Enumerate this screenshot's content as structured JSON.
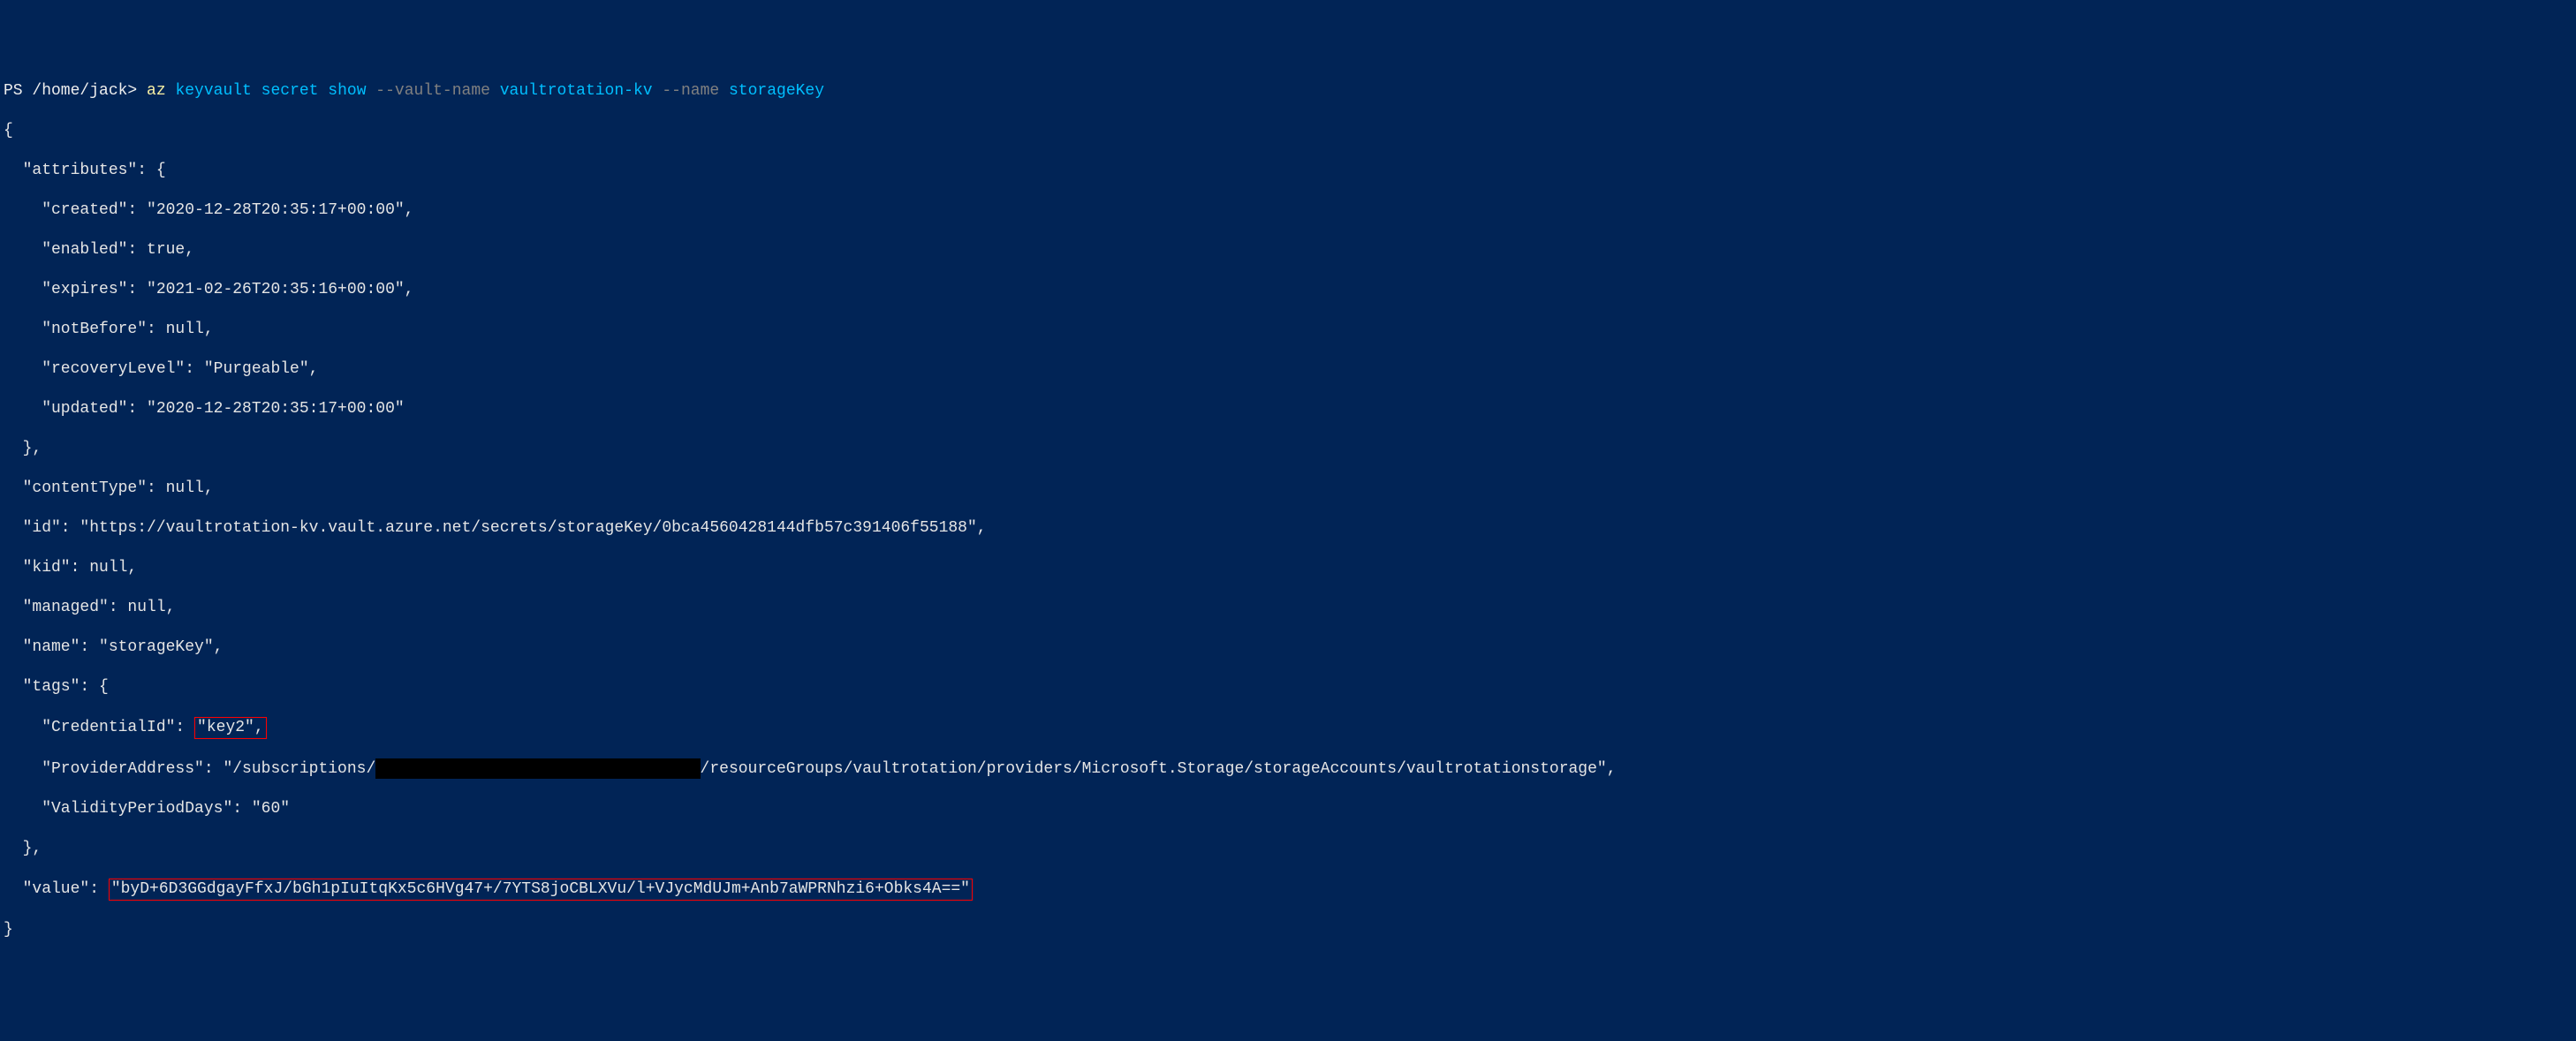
{
  "prompt": {
    "prefix": "PS /home/jack> ",
    "cmd": "az",
    "sub1": " keyvault",
    "sub2": " secret",
    "sub3": " show",
    "flag1": " --vault-name",
    "val1": " vaultrotation-kv",
    "flag2": " --name",
    "val2": " storageKey"
  },
  "json": {
    "open": "{",
    "attr_open": "  \"attributes\": {",
    "created": "    \"created\": \"2020-12-28T20:35:17+00:00\",",
    "enabled": "    \"enabled\": true,",
    "expires": "    \"expires\": \"2021-02-26T20:35:16+00:00\",",
    "notBefore": "    \"notBefore\": null,",
    "recoveryLevel": "    \"recoveryLevel\": \"Purgeable\",",
    "updated": "    \"updated\": \"2020-12-28T20:35:17+00:00\"",
    "attr_close": "  },",
    "contentType": "  \"contentType\": null,",
    "id": "  \"id\": \"https://vaultrotation-kv.vault.azure.net/secrets/storageKey/0bca4560428144dfb57c391406f55188\",",
    "kid": "  \"kid\": null,",
    "managed": "  \"managed\": null,",
    "name": "  \"name\": \"storageKey\",",
    "tags_open": "  \"tags\": {",
    "cred_prefix": "    \"CredentialId\": ",
    "cred_val": "\"key2\",",
    "provider_prefix": "    \"ProviderAddress\": \"/subscriptions/",
    "provider_redacted": "                                  ",
    "provider_suffix": "/resourceGroups/vaultrotation/providers/Microsoft.Storage/storageAccounts/vaultrotationstorage\",",
    "validity": "    \"ValidityPeriodDays\": \"60\"",
    "tags_close": "  },",
    "value_prefix": "  \"value\": ",
    "value_val": "\"byD+6D3GGdgayFfxJ/bGh1pIuItqKx5c6HVg47+/7YTS8joCBLXVu/l+VJycMdUJm+Anb7aWPRNhzi6+Obks4A==\"",
    "close": "}"
  },
  "chart_data": {
    "type": "table",
    "title": "Azure Key Vault Secret Output",
    "data": {
      "attributes": {
        "created": "2020-12-28T20:35:17+00:00",
        "enabled": true,
        "expires": "2021-02-26T20:35:16+00:00",
        "notBefore": null,
        "recoveryLevel": "Purgeable",
        "updated": "2020-12-28T20:35:17+00:00"
      },
      "contentType": null,
      "id": "https://vaultrotation-kv.vault.azure.net/secrets/storageKey/0bca4560428144dfb57c391406f55188",
      "kid": null,
      "managed": null,
      "name": "storageKey",
      "tags": {
        "CredentialId": "key2",
        "ProviderAddress": "/subscriptions/[redacted]/resourceGroups/vaultrotation/providers/Microsoft.Storage/storageAccounts/vaultrotationstorage",
        "ValidityPeriodDays": "60"
      },
      "value": "byD+6D3GGdgayFfxJ/bGh1pIuItqKx5c6HVg47+/7YTS8joCBLXVu/l+VJycMdUJm+Anb7aWPRNhzi6+Obks4A=="
    }
  }
}
